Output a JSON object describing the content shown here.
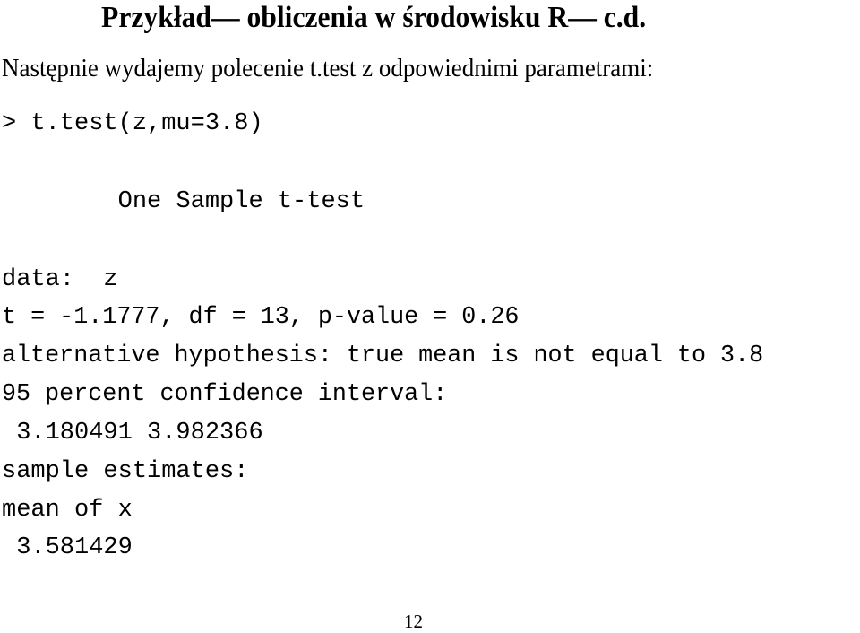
{
  "slide": {
    "title": "Przykład— obliczenia w środowisku R— c.d.",
    "intro": "Następnie wydajemy polecenie t.test z odpowiednimi parametrami:",
    "console": {
      "command": "> t.test(z,mu=3.8)",
      "test_name": "        One Sample t-test",
      "data_line": "data:  z",
      "stats_line": "t = -1.1777, df = 13, p-value = 0.26",
      "alternative_line": "alternative hypothesis: true mean is not equal to 3.8",
      "ci_label": "95 percent confidence interval:",
      "ci_values": " 3.180491 3.982366",
      "estimates_label": "sample estimates:",
      "estimate_name": "mean of x",
      "estimate_value": " 3.581429"
    },
    "page_number": "12"
  }
}
